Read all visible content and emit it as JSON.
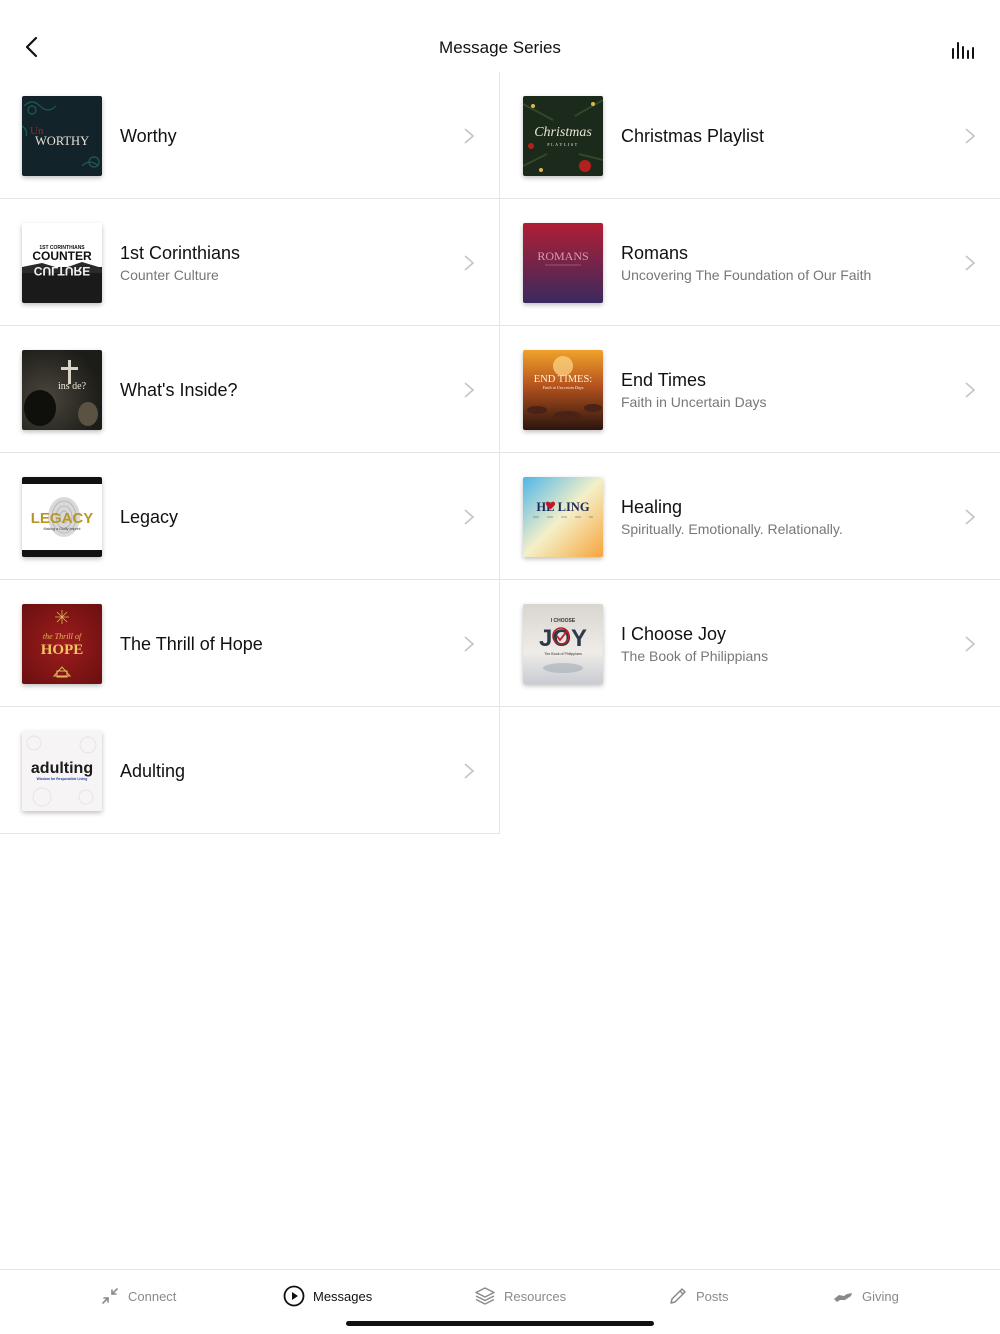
{
  "header": {
    "title": "Message Series",
    "back_icon": "chevron-left-icon",
    "stats_icon": "bar-chart-icon"
  },
  "series_left": [
    {
      "title": "Worthy",
      "subtitle": "",
      "art_text": "WORTHY",
      "art_small": "Un"
    },
    {
      "title": "1st Corinthians",
      "subtitle": "Counter Culture",
      "art_text": "COUNTER",
      "art_small": "1ST CORINTHIANS",
      "art_text2": "CULTURE"
    },
    {
      "title": "What's Inside?",
      "subtitle": "",
      "art_text": "ins de?"
    },
    {
      "title": "Legacy",
      "subtitle": "",
      "art_text": "LEGACY",
      "art_small": "Making a Godly Imprint"
    },
    {
      "title": "The Thrill of Hope",
      "subtitle": "",
      "art_text": "HOPE",
      "art_small": "the Thrill of"
    },
    {
      "title": "Adulting",
      "subtitle": "",
      "art_text": "adulting",
      "art_small": "Wisdom for Responsible Living"
    }
  ],
  "series_right": [
    {
      "title": "Christmas Playlist",
      "subtitle": "",
      "art_text": "Christmas",
      "art_small": "PLAYLIST"
    },
    {
      "title": "Romans",
      "subtitle": "Uncovering The Foundation of Our Faith",
      "art_text": "ROMANS"
    },
    {
      "title": "End Times",
      "subtitle": "Faith in Uncertain Days",
      "art_text": "END TIMES:",
      "art_small": "Faith in Uncertain Days"
    },
    {
      "title": "Healing",
      "subtitle": "Spiritually. Emotionally. Relationally.",
      "art_text": "HE LING"
    },
    {
      "title": "I Choose Joy",
      "subtitle": "The Book of Philippians",
      "art_text": "JOY",
      "art_small": "I CHOOSE",
      "art_small2": "The Book of Philippians"
    }
  ],
  "tabs": [
    {
      "label": "Connect",
      "icon": "connect-arrows-icon",
      "active": false
    },
    {
      "label": "Messages",
      "icon": "play-circle-icon",
      "active": true
    },
    {
      "label": "Resources",
      "icon": "layers-icon",
      "active": false
    },
    {
      "label": "Posts",
      "icon": "pencil-icon",
      "active": false
    },
    {
      "label": "Giving",
      "icon": "giving-hand-icon",
      "active": false
    }
  ],
  "colors": {
    "active_tab": "#111111",
    "inactive_tab": "#8a8a8a",
    "divider": "#e4e4e4"
  }
}
